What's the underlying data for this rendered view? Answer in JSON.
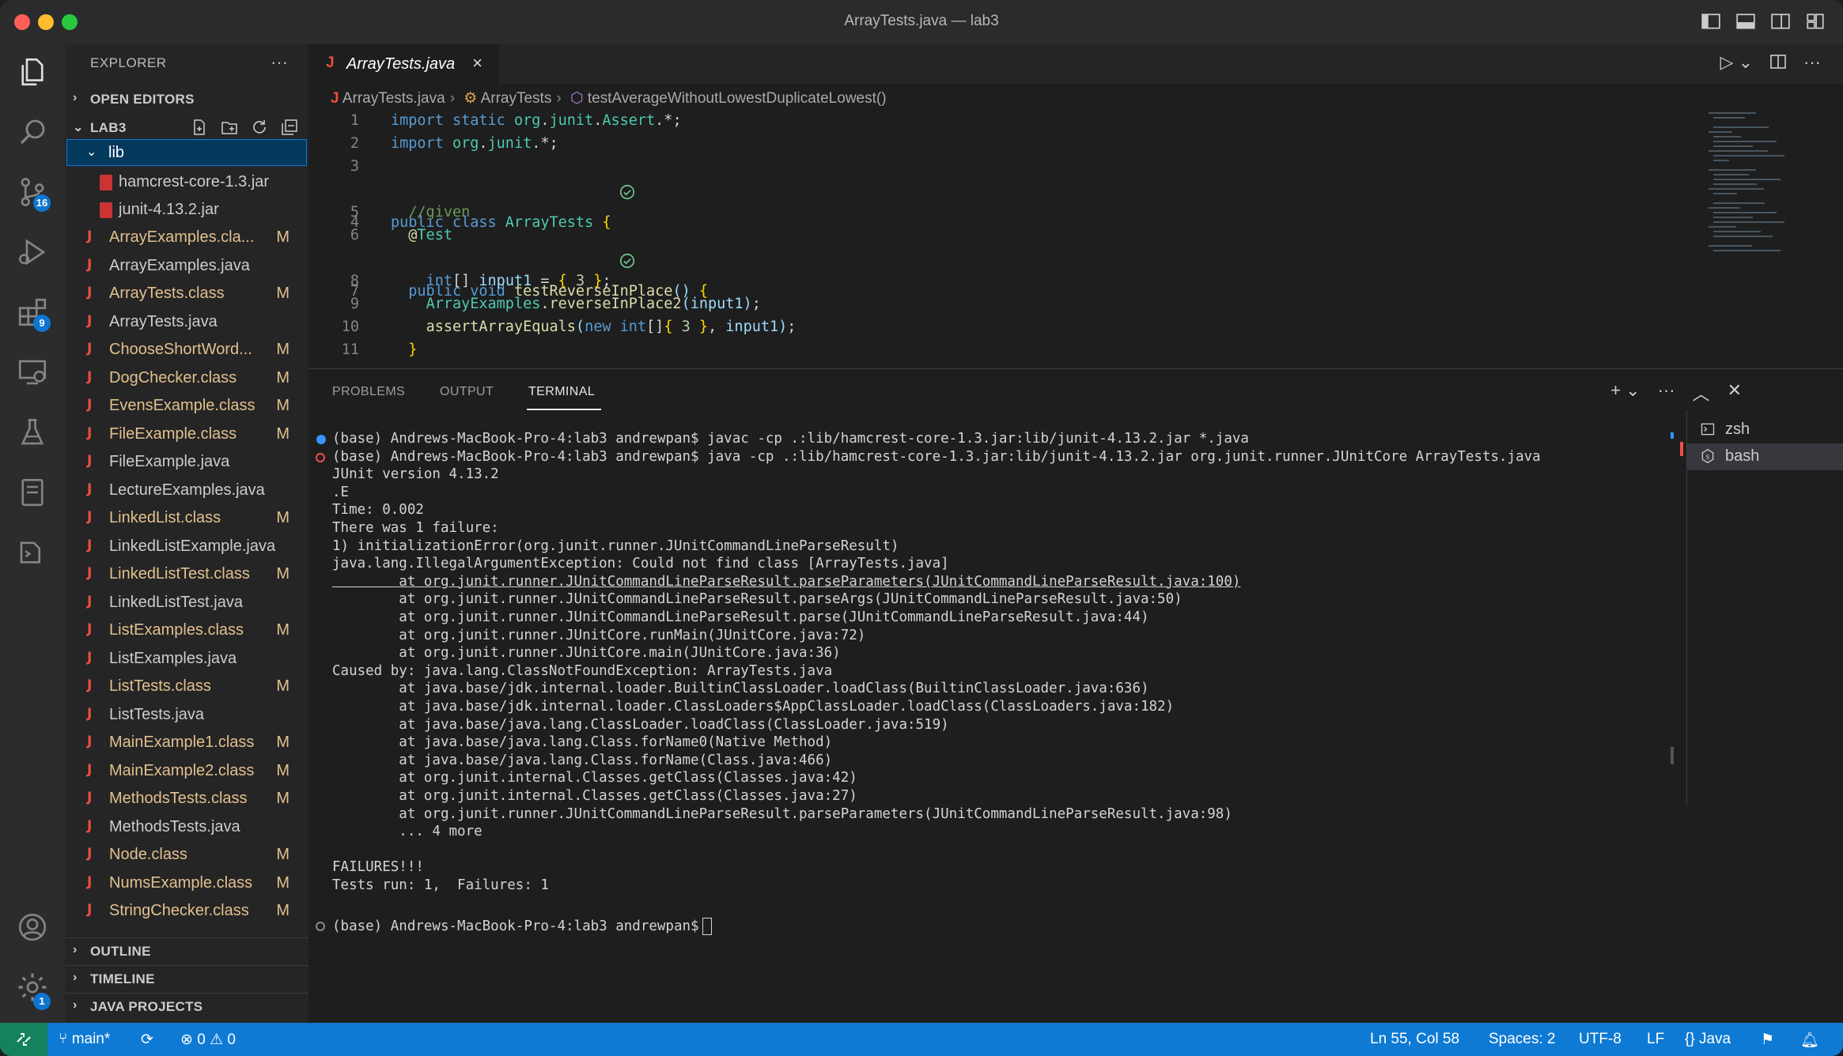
{
  "window": {
    "title": "ArrayTests.java — lab3"
  },
  "activity": {
    "scm_badge": "16",
    "extensions_badge": "9",
    "settings_badge": "1"
  },
  "explorer": {
    "header": "EXPLORER",
    "more": "···",
    "open_editors": "OPEN EDITORS",
    "folder": "LAB3",
    "lib": {
      "name": "lib",
      "files": [
        "hamcrest-core-1.3.jar",
        "junit-4.13.2.jar"
      ]
    },
    "files": [
      {
        "name": "ArrayExamples.cla...",
        "status": "M"
      },
      {
        "name": "ArrayExamples.java",
        "status": ""
      },
      {
        "name": "ArrayTests.class",
        "status": "M"
      },
      {
        "name": "ArrayTests.java",
        "status": ""
      },
      {
        "name": "ChooseShortWord...",
        "status": "M"
      },
      {
        "name": "DogChecker.class",
        "status": "M"
      },
      {
        "name": "EvensExample.class",
        "status": "M"
      },
      {
        "name": "FileExample.class",
        "status": "M"
      },
      {
        "name": "FileExample.java",
        "status": ""
      },
      {
        "name": "LectureExamples.java",
        "status": ""
      },
      {
        "name": "LinkedList.class",
        "status": "M"
      },
      {
        "name": "LinkedListExample.java",
        "status": ""
      },
      {
        "name": "LinkedListTest.class",
        "status": "M"
      },
      {
        "name": "LinkedListTest.java",
        "status": ""
      },
      {
        "name": "ListExamples.class",
        "status": "M"
      },
      {
        "name": "ListExamples.java",
        "status": ""
      },
      {
        "name": "ListTests.class",
        "status": "M"
      },
      {
        "name": "ListTests.java",
        "status": ""
      },
      {
        "name": "MainExample1.class",
        "status": "M"
      },
      {
        "name": "MainExample2.class",
        "status": "M"
      },
      {
        "name": "MethodsTests.class",
        "status": "M"
      },
      {
        "name": "MethodsTests.java",
        "status": ""
      },
      {
        "name": "Node.class",
        "status": "M"
      },
      {
        "name": "NumsExample.class",
        "status": "M"
      },
      {
        "name": "StringChecker.class",
        "status": "M"
      }
    ],
    "outline": "OUTLINE",
    "timeline": "TIMELINE",
    "java_projects": "JAVA PROJECTS"
  },
  "editor": {
    "tab_label": "ArrayTests.java",
    "breadcrumb": [
      "ArrayTests.java",
      "ArrayTests",
      "testAverageWithoutLowestDuplicateLowest()"
    ],
    "line_numbers": [
      "1",
      "2",
      "3",
      "4",
      "5",
      "6",
      "7",
      "8",
      "9",
      "10",
      "11"
    ]
  },
  "panel": {
    "tabs": [
      "PROBLEMS",
      "OUTPUT",
      "TERMINAL"
    ],
    "terminal_lines": [
      "(base) Andrews-MacBook-Pro-4:lab3 andrewpan$ javac -cp .:lib/hamcrest-core-1.3.jar:lib/junit-4.13.2.jar *.java",
      "(base) Andrews-MacBook-Pro-4:lab3 andrewpan$ java -cp .:lib/hamcrest-core-1.3.jar:lib/junit-4.13.2.jar org.junit.runner.JUnitCore ArrayTests.java",
      "JUnit version 4.13.2",
      ".E",
      "Time: 0.002",
      "There was 1 failure:",
      "1) initializationError(org.junit.runner.JUnitCommandLineParseResult)",
      "java.lang.IllegalArgumentException: Could not find class [ArrayTests.java]",
      "        at org.junit.runner.JUnitCommandLineParseResult.parseParameters(JUnitCommandLineParseResult.java:100)",
      "        at org.junit.runner.JUnitCommandLineParseResult.parseArgs(JUnitCommandLineParseResult.java:50)",
      "        at org.junit.runner.JUnitCommandLineParseResult.parse(JUnitCommandLineParseResult.java:44)",
      "        at org.junit.runner.JUnitCore.runMain(JUnitCore.java:72)",
      "        at org.junit.runner.JUnitCore.main(JUnitCore.java:36)",
      "Caused by: java.lang.ClassNotFoundException: ArrayTests.java",
      "        at java.base/jdk.internal.loader.BuiltinClassLoader.loadClass(BuiltinClassLoader.java:636)",
      "        at java.base/jdk.internal.loader.ClassLoaders$AppClassLoader.loadClass(ClassLoaders.java:182)",
      "        at java.base/java.lang.ClassLoader.loadClass(ClassLoader.java:519)",
      "        at java.base/java.lang.Class.forName0(Native Method)",
      "        at java.base/java.lang.Class.forName(Class.java:466)",
      "        at org.junit.internal.Classes.getClass(Classes.java:42)",
      "        at org.junit.internal.Classes.getClass(Classes.java:27)",
      "        at org.junit.runner.JUnitCommandLineParseResult.parseParameters(JUnitCommandLineParseResult.java:98)",
      "        ... 4 more",
      "",
      "FAILURES!!!",
      "Tests run: 1,  Failures: 1",
      "",
      "(base) Andrews-MacBook-Pro-4:lab3 andrewpan$"
    ],
    "terminals": [
      "zsh",
      "bash"
    ]
  },
  "status": {
    "branch": "main*",
    "errors": "0",
    "warnings": "0",
    "position": "Ln 55, Col 58",
    "spaces": "Spaces: 2",
    "encoding": "UTF-8",
    "eol": "LF",
    "language": "Java"
  },
  "colors": {
    "accent": "#0e7ad3",
    "remote": "#16825d",
    "modified": "#e2c08d",
    "java_icon": "#e84f3f"
  }
}
